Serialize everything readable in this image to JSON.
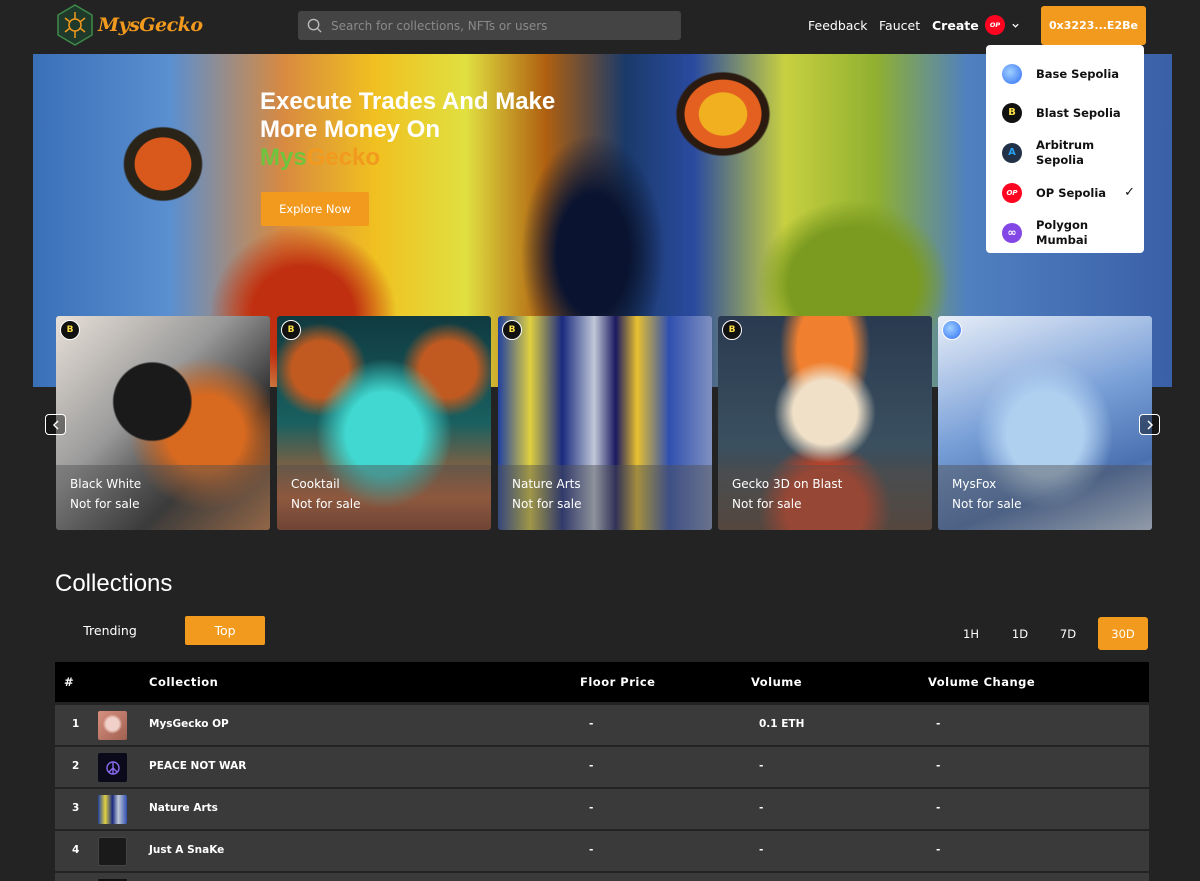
{
  "header": {
    "brand": "MysGecko",
    "search_placeholder": "Search for collections, NFTs or users",
    "nav": [
      "Feedback",
      "Faucet",
      "Create"
    ],
    "chain_badge": "OP",
    "wallet": "0x3223...E2Be"
  },
  "hero": {
    "title_line1": "Execute Trades And Make",
    "title_line2": "More Money On",
    "brand_part1": "Mys",
    "brand_part2": "Gecko",
    "cta": "Explore Now"
  },
  "chains": [
    {
      "name_line1": "Base Sepolia",
      "name_line2": "",
      "icon": "base-icon",
      "color": "#2f6df6"
    },
    {
      "name_line1": "Blast Sepolia",
      "name_line2": "",
      "icon": "blast-icon",
      "color": "#111111"
    },
    {
      "name_line1": "Arbitrum",
      "name_line2": "Sepolia",
      "icon": "arbitrum-icon",
      "color": "#213147"
    },
    {
      "name_line1": "OP Sepolia",
      "name_line2": "",
      "icon": "op-icon",
      "color": "#ff0420",
      "selected": true
    },
    {
      "name_line1": "Polygon",
      "name_line2": "Mumbai",
      "icon": "polygon-icon",
      "color": "#8247e5"
    }
  ],
  "featured": [
    {
      "name": "Black White",
      "price": "Not for sale",
      "chain": "blast-icon"
    },
    {
      "name": "Cooktail",
      "price": "Not for sale",
      "chain": "blast-icon"
    },
    {
      "name": "Nature Arts",
      "price": "Not for sale",
      "chain": "blast-icon"
    },
    {
      "name": "Gecko 3D on Blast",
      "price": "Not for sale",
      "chain": "blast-icon"
    },
    {
      "name": "MysFox",
      "price": "Not for sale",
      "chain": "base-icon"
    }
  ],
  "collections": {
    "title": "Collections",
    "tabs": [
      "Trending",
      "Top"
    ],
    "active_tab": "Top",
    "periods": [
      "1H",
      "1D",
      "7D",
      "30D"
    ],
    "active_period": "30D",
    "columns": [
      "#",
      "Collection",
      "Floor Price",
      "Volume",
      "Volume Change"
    ],
    "rows": [
      {
        "rank": "1",
        "name": "MysGecko OP",
        "floor": "-",
        "volume": "0.1 ETH",
        "change": "-"
      },
      {
        "rank": "2",
        "name": "PEACE NOT WAR",
        "floor": "-",
        "volume": "-",
        "change": "-"
      },
      {
        "rank": "3",
        "name": "Nature Arts",
        "floor": "-",
        "volume": "-",
        "change": "-"
      },
      {
        "rank": "4",
        "name": "Just A SnaKe",
        "floor": "-",
        "volume": "-",
        "change": "-"
      }
    ]
  }
}
